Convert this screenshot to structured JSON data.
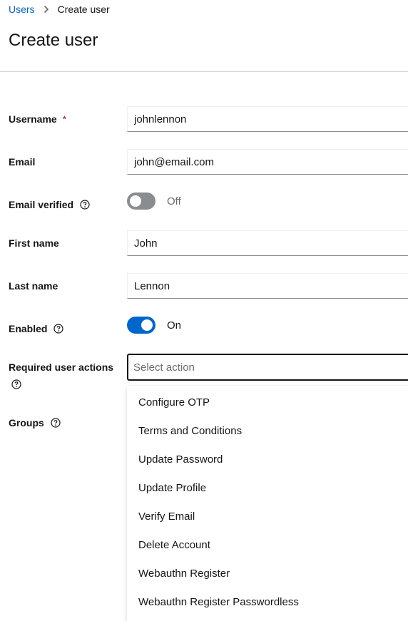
{
  "breadcrumb": {
    "parent_label": "Users",
    "current_label": "Create user"
  },
  "page": {
    "title": "Create user"
  },
  "form": {
    "username": {
      "label": "Username",
      "required_marker": "*",
      "value": "johnlennon"
    },
    "email": {
      "label": "Email",
      "value": "john@email.com"
    },
    "email_verified": {
      "label": "Email verified",
      "state": "off",
      "state_label": "Off"
    },
    "first_name": {
      "label": "First name",
      "value": "John"
    },
    "last_name": {
      "label": "Last name",
      "value": "Lennon"
    },
    "enabled": {
      "label": "Enabled",
      "state": "on",
      "state_label": "On"
    },
    "required_user_actions": {
      "label": "Required user actions",
      "placeholder": "Select action",
      "options": [
        "Configure OTP",
        "Terms and Conditions",
        "Update Password",
        "Update Profile",
        "Verify Email",
        "Delete Account",
        "Webauthn Register",
        "Webauthn Register Passwordless"
      ]
    },
    "groups": {
      "label": "Groups"
    }
  },
  "icons": {
    "help": "help-circle-icon",
    "breadcrumb_separator": "chevron-right-icon"
  },
  "colors": {
    "link": "#0066cc",
    "required": "#c9190b",
    "switch_on": "#0066cc",
    "switch_off": "#8a8d90"
  }
}
